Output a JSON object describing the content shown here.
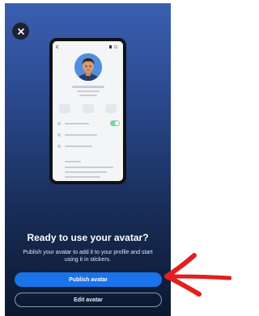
{
  "dialog": {
    "title": "Ready to use your avatar?",
    "subtitle": "Publish your avatar to add it to your profile and start using it in stickers.",
    "primary_button": "Publish avatar",
    "secondary_button": "Edit avatar"
  },
  "icons": {
    "close": "close-icon",
    "annotation": "red-arrow"
  },
  "colors": {
    "primary": "#1a73e8",
    "annotation": "#e21e1e"
  }
}
